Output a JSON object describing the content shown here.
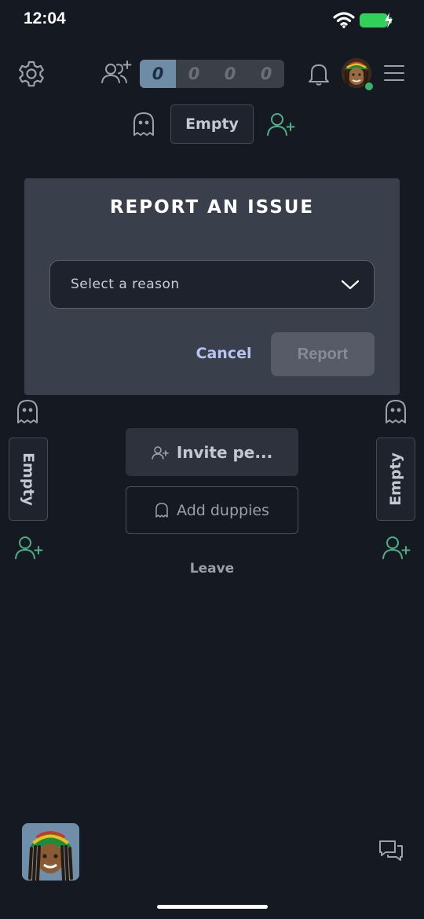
{
  "status_bar": {
    "time": "12:04"
  },
  "top_bar": {
    "score_digits": [
      "0",
      "0",
      "0",
      "0"
    ]
  },
  "seats": {
    "top_label": "Empty",
    "left_label": "Empty",
    "right_label": "Empty"
  },
  "actions": {
    "invite_label": "Invite pe...",
    "add_duppies_label": "Add duppies",
    "leave_label": "Leave"
  },
  "modal": {
    "title": "REPORT AN ISSUE",
    "select_placeholder": "Select a reason",
    "cancel_label": "Cancel",
    "report_label": "Report"
  },
  "colors": {
    "background": "#151922",
    "modal_bg": "#3a3f4c",
    "accent_green": "#3bb36a",
    "score_active": "#6f8ca6"
  }
}
